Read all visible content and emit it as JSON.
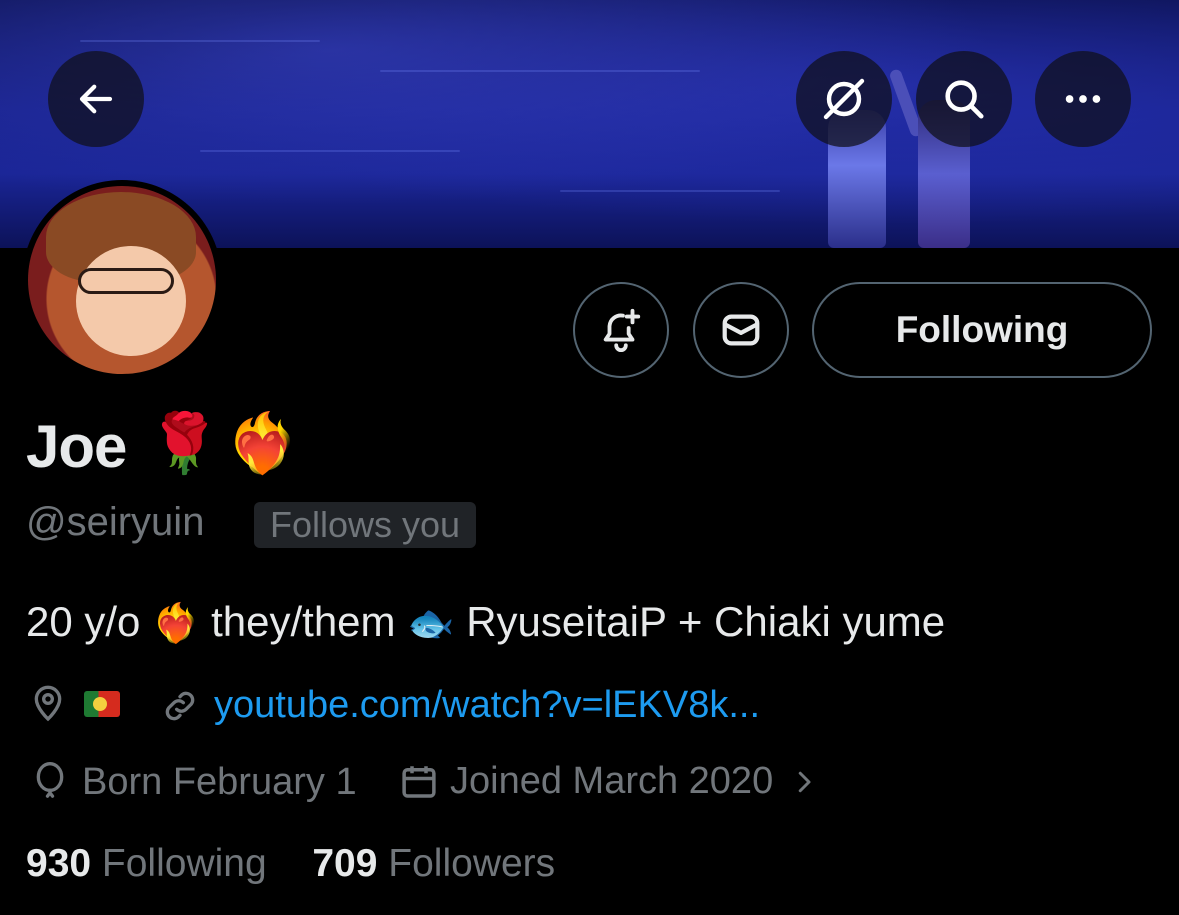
{
  "profile": {
    "name": "Joe",
    "name_emojis": [
      "🌹",
      "❤️‍🔥"
    ],
    "handle": "@seiryuin",
    "follows_you": "Follows you",
    "bio": {
      "age": "20 y/o",
      "emoji1": "❤️‍🔥",
      "pronouns": "they/them",
      "emoji2": "🐟",
      "interests": "RyuseitaiP + Chiaki yume"
    },
    "location_flag": "Portugal flag",
    "website": "youtube.com/watch?v=lEKV8k...",
    "birthday": "Born February 1",
    "joined": "Joined March 2020",
    "following_count": "930",
    "following_label": "Following",
    "followers_count": "709",
    "followers_label": "Followers"
  },
  "actions": {
    "following_button": "Following"
  },
  "icons": {
    "back": "arrow-left-icon",
    "grok": "grok-icon",
    "search": "search-icon",
    "more": "more-icon",
    "notify": "bell-plus-icon",
    "message": "envelope-icon",
    "location": "location-pin-icon",
    "link": "link-icon",
    "birthday": "balloon-icon",
    "calendar": "calendar-icon",
    "chevron": "chevron-right-icon"
  },
  "colors": {
    "background": "#000000",
    "text_primary": "#e7e9ea",
    "text_secondary": "#71767b",
    "link": "#1d9bf0",
    "border": "#536471",
    "badge_bg": "#202327"
  }
}
